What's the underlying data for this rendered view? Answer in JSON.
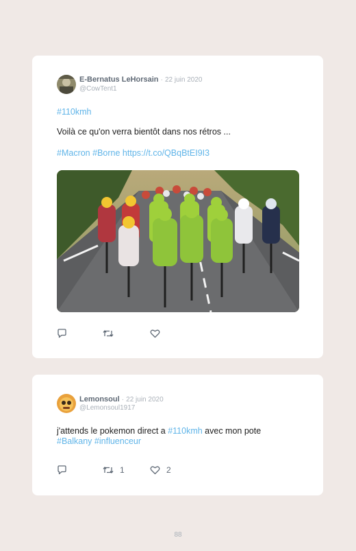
{
  "tweets": [
    {
      "author": "E-Bernatus LeHorsain",
      "separator": "·",
      "date": "22 juin 2020",
      "handle": "@CowTent1",
      "hashtag_line": "#110kmh",
      "text": "Voilà ce qu'on verra bientôt dans nos rétros ...",
      "tags_line": {
        "tag1": "#Macron",
        "tag2": "#Borne",
        "link": "https://t.co/QBqBtEI9I3"
      },
      "reply_count": "",
      "retweet_count": "",
      "like_count": ""
    },
    {
      "author": "Lemonsoul",
      "separator": "·",
      "date": "22 juin 2020",
      "handle": "@Lemonsoul1917",
      "text_before": "j'attends le pokemon direct a ",
      "tag_inline": "#110kmh",
      "text_after": " avec mon pote",
      "tag2": "#Balkany",
      "tag3": "#influenceur",
      "reply_count": "",
      "retweet_count": "1",
      "like_count": "2"
    }
  ],
  "page_number": "88",
  "colors": {
    "background": "#f0e9e6",
    "card": "#ffffff",
    "hashtag": "#5fb4e8",
    "muted": "#a9b0b8",
    "name": "#5f6975"
  },
  "icons": [
    "reply-icon",
    "retweet-icon",
    "like-icon"
  ]
}
